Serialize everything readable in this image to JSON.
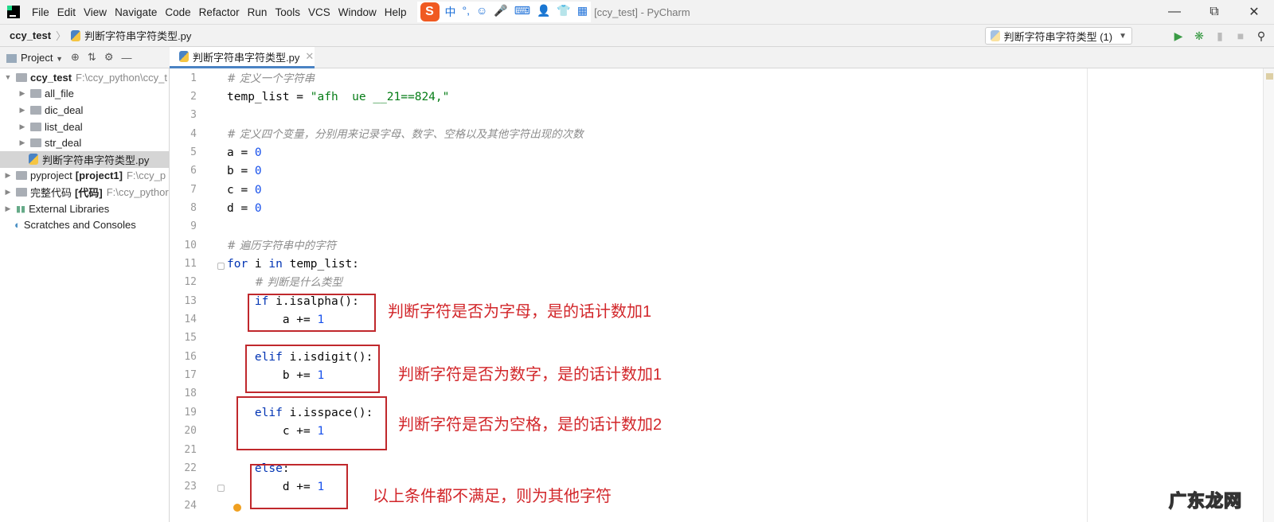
{
  "menubar": {
    "items": [
      "File",
      "Edit",
      "View",
      "Navigate",
      "Code",
      "Refactor",
      "Run",
      "Tools",
      "VCS",
      "Window",
      "Help"
    ],
    "window_title": "[ccy_test] - PyCharm",
    "ime": [
      "中",
      "°,",
      "☺",
      "🎤",
      "⌨",
      "👤",
      "👕",
      "▦"
    ]
  },
  "navbar": {
    "project": "ccy_test",
    "file": "判断字符串字符类型.py"
  },
  "run_config": {
    "label": "判断字符串字符类型 (1)"
  },
  "tool_window": {
    "title": "Project"
  },
  "editor_tab": {
    "label": "判断字符串字符类型.py"
  },
  "tree": [
    {
      "label": "ccy_test",
      "path": "F:\\ccy_python\\ccy_t",
      "bold": true,
      "level": 0,
      "open": true
    },
    {
      "label": "all_file",
      "level": 1
    },
    {
      "label": "dic_deal",
      "level": 1
    },
    {
      "label": "list_deal",
      "level": 1
    },
    {
      "label": "str_deal",
      "level": 1
    },
    {
      "label": "判断字符串字符类型.py",
      "level": 1,
      "file": true,
      "selected": true
    },
    {
      "label": "pyproject",
      "tag": "[project1]",
      "path": "F:\\ccy_p",
      "level": 0
    },
    {
      "label": "完整代码",
      "tag": "[代码]",
      "path": "F:\\ccy_pythor",
      "level": 0
    },
    {
      "label": "External Libraries",
      "level": 0,
      "lib": true
    },
    {
      "label": "Scratches and Consoles",
      "level": 0,
      "scratch": true
    }
  ],
  "code": [
    [
      [
        "c",
        "# 定义一个字符串"
      ]
    ],
    [
      [
        "p",
        "temp_list = "
      ],
      [
        "s",
        "\"afh  ue __21==824,\""
      ]
    ],
    [],
    [
      [
        "c",
        "# 定义四个变量，分别用来记录字母、数字、空格以及其他字符出现的次数"
      ]
    ],
    [
      [
        "p",
        "a = "
      ],
      [
        "n",
        "0"
      ]
    ],
    [
      [
        "p",
        "b = "
      ],
      [
        "n",
        "0"
      ]
    ],
    [
      [
        "p",
        "c = "
      ],
      [
        "n",
        "0"
      ]
    ],
    [
      [
        "p",
        "d = "
      ],
      [
        "n",
        "0"
      ]
    ],
    [],
    [
      [
        "c",
        "# 遍历字符串中的字符"
      ]
    ],
    [
      [
        "k",
        "for"
      ],
      [
        "p",
        " i "
      ],
      [
        "k",
        "in"
      ],
      [
        "p",
        " temp_list:"
      ]
    ],
    [
      [
        "p",
        "    "
      ],
      [
        "c",
        "# 判断是什么类型"
      ]
    ],
    [
      [
        "p",
        "    "
      ],
      [
        "k",
        "if"
      ],
      [
        "p",
        " i.isalpha():"
      ]
    ],
    [
      [
        "p",
        "        a += "
      ],
      [
        "n",
        "1"
      ]
    ],
    [],
    [
      [
        "p",
        "    "
      ],
      [
        "k",
        "elif"
      ],
      [
        "p",
        " i.isdigit():"
      ]
    ],
    [
      [
        "p",
        "        b += "
      ],
      [
        "n",
        "1"
      ]
    ],
    [],
    [
      [
        "p",
        "    "
      ],
      [
        "k",
        "elif"
      ],
      [
        "p",
        " i.isspace():"
      ]
    ],
    [
      [
        "p",
        "        c += "
      ],
      [
        "n",
        "1"
      ]
    ],
    [],
    [
      [
        "p",
        "    "
      ],
      [
        "k",
        "else"
      ],
      [
        "p",
        ":"
      ]
    ],
    [
      [
        "p",
        "        d += "
      ],
      [
        "n",
        "1"
      ]
    ],
    []
  ],
  "annotations": [
    "判断字符是否为字母，是的话计数加1",
    "判断字符是否为数字，是的话计数加1",
    "判断字符是否为空格，是的话计数加2",
    "以上条件都不满足，则为其他字符"
  ],
  "watermark": "广东龙网"
}
